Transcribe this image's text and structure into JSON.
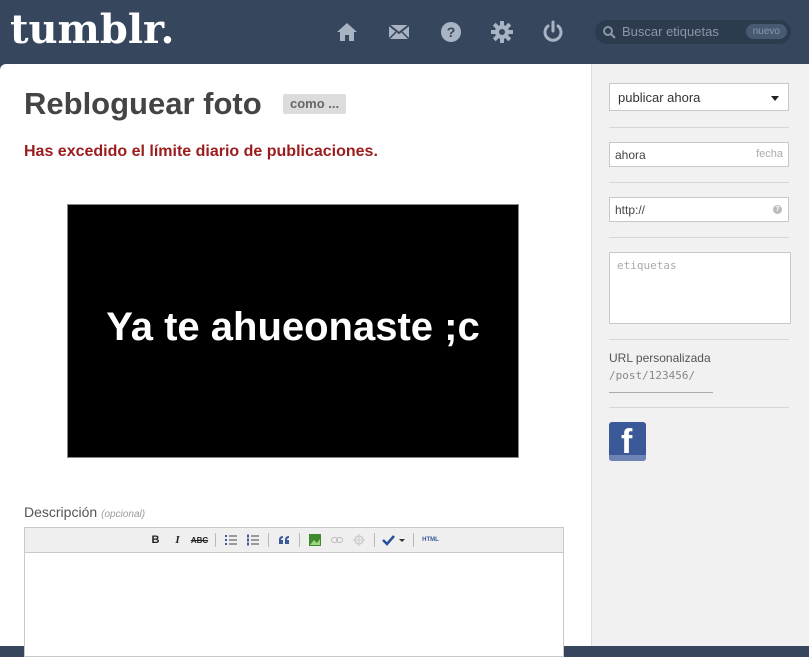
{
  "header": {
    "logo": "tumblr.",
    "nav": [
      {
        "name": "home-icon"
      },
      {
        "name": "mail-icon"
      },
      {
        "name": "help-icon"
      },
      {
        "name": "gear-icon"
      },
      {
        "name": "power-icon"
      }
    ],
    "search": {
      "placeholder": "Buscar etiquetas",
      "badge": "nuevo"
    }
  },
  "main": {
    "title": "Rebloguear foto",
    "como_button": "como ...",
    "error": "Has excedido el límite diario de publicaciones.",
    "photo_caption": "Ya te ahueonaste ;c",
    "description": {
      "label": "Descripción",
      "optional": "(opcional)"
    },
    "toolbar": {
      "bold": "B",
      "italic": "I",
      "strike": "ABC",
      "html": "HTML"
    }
  },
  "sidebar": {
    "publish_select": "publicar ahora",
    "date": {
      "value": "ahora",
      "hint": "fecha"
    },
    "url": {
      "value": "http://",
      "help": "?"
    },
    "tags_placeholder": "etiquetas",
    "custom_url": {
      "label": "URL personalizada",
      "value": "/post/123456/"
    },
    "facebook": {
      "letter": "f"
    }
  },
  "colors": {
    "header_bg": "#36465d",
    "error_text": "#9b1c1c",
    "facebook": "#3b5998"
  }
}
